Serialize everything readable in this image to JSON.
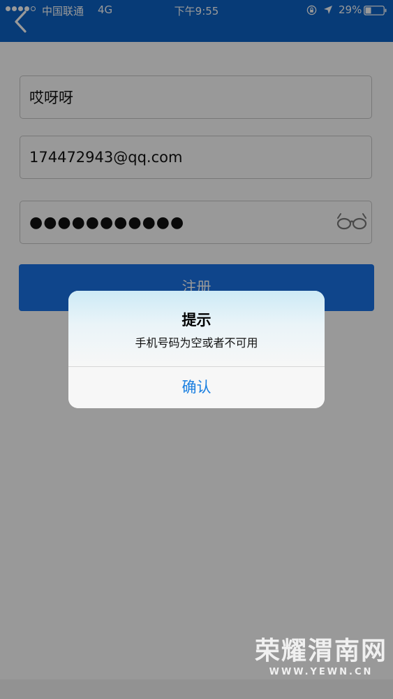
{
  "status_bar": {
    "carrier": "中国联通",
    "network": "4G",
    "time": "下午9:55",
    "battery_percent": "29%",
    "icons": [
      "signal-dots-icon",
      "orientation-lock-icon",
      "location-arrow-icon",
      "battery-icon"
    ]
  },
  "nav": {
    "back_icon": "chevron-left-icon"
  },
  "form": {
    "username_value": "哎呀呀",
    "email_value": "174472943@qq.com",
    "password_masked": "●●●●●●●●●●●",
    "reveal_icon": "glasses-icon",
    "register_label": "注册"
  },
  "alert": {
    "title": "提示",
    "message": "手机号码为空或者不可用",
    "confirm_label": "确认"
  },
  "watermark": {
    "main": "荣耀渭南网",
    "sub": "WWW.YEWN.CN"
  },
  "colors": {
    "header_blue": "#0d63c6",
    "button_blue": "#1a73e8",
    "alert_link_blue": "#1a7fe0"
  }
}
